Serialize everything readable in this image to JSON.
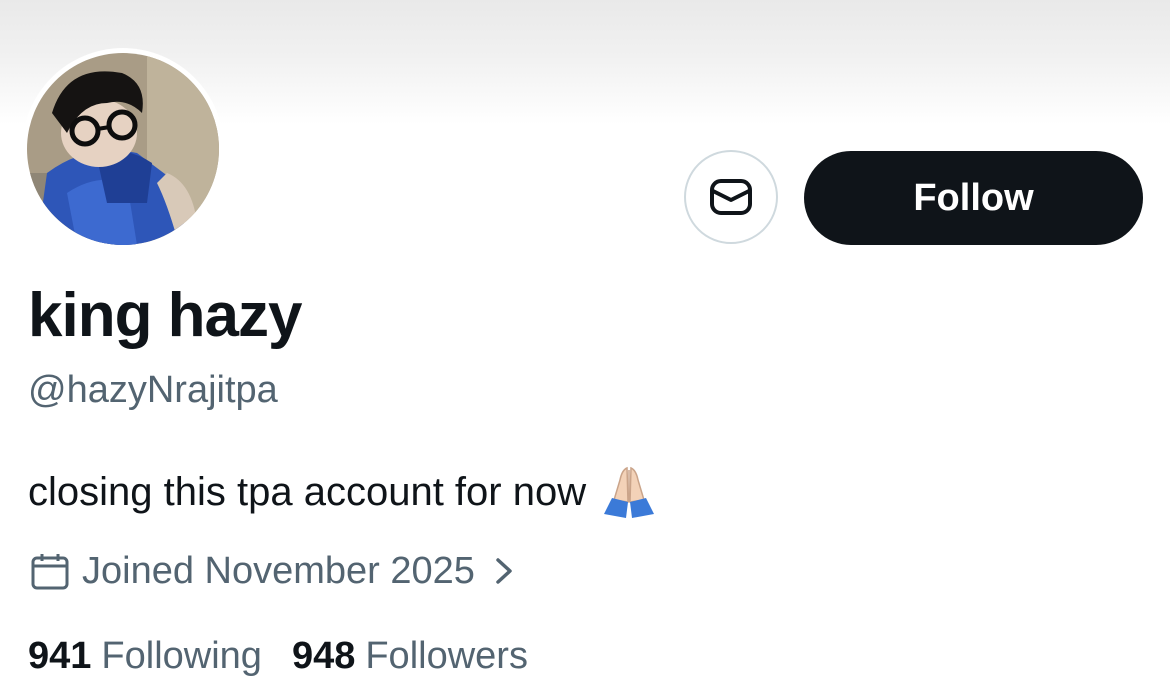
{
  "profile": {
    "display_name": "king hazy",
    "handle": "@hazyNrajitpa",
    "bio": "closing this tpa account for now",
    "bio_emoji": "folded-hands-emoji",
    "joined": "Joined November 2025",
    "avatar": "profile-photo"
  },
  "actions": {
    "message_icon": "envelope-icon",
    "follow_label": "Follow"
  },
  "stats": {
    "following_count": "941",
    "following_label": "Following",
    "followers_count": "948",
    "followers_label": "Followers"
  },
  "colors": {
    "text_primary": "#0f1419",
    "text_secondary": "#536471",
    "button_dark": "#0f1419",
    "border": "#cfd9de"
  }
}
